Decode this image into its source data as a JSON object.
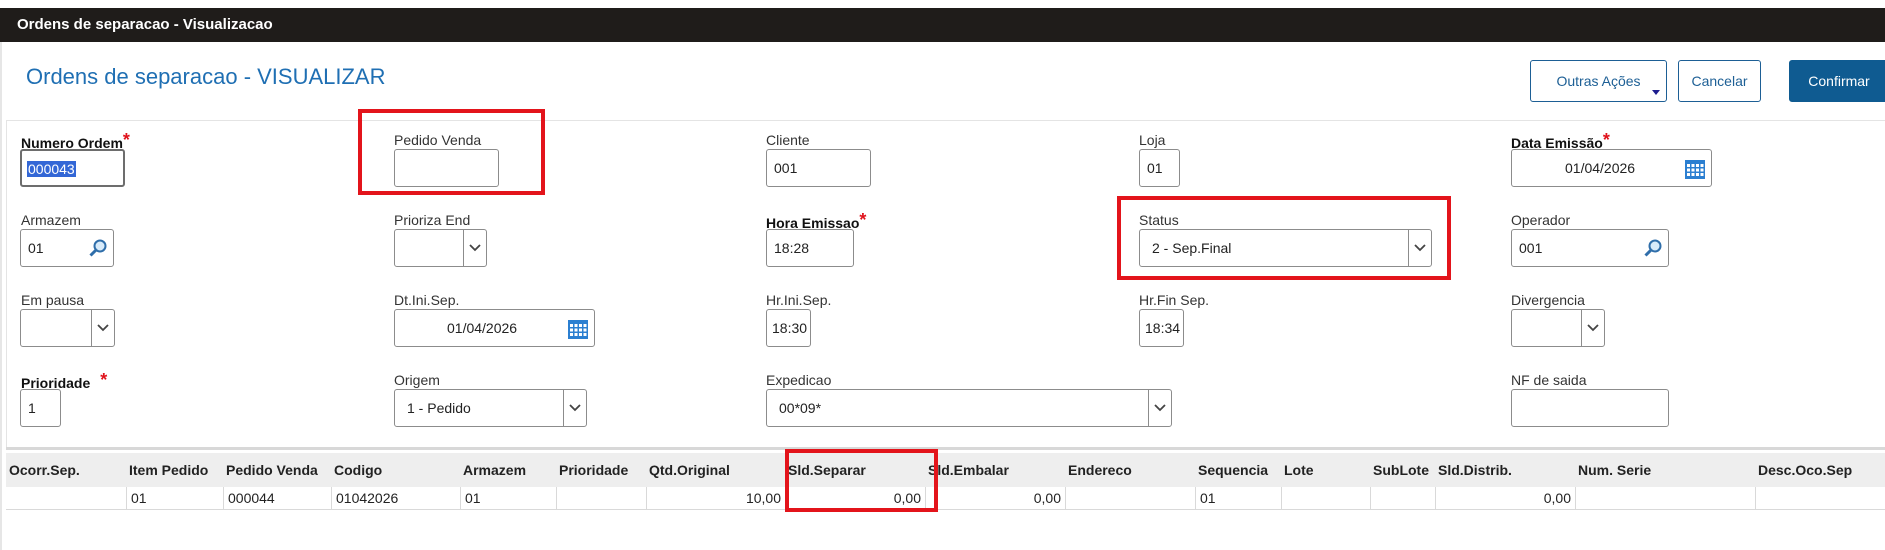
{
  "window": {
    "title": "Ordens de separacao - Visualizacao"
  },
  "page": {
    "title": "Ordens de separacao - VISUALIZAR"
  },
  "toolbar": {
    "outras_label": "Outras Ações",
    "cancelar_label": "Cancelar",
    "confirmar_label": "Confirmar"
  },
  "fields": {
    "numero_ordem": {
      "label": "Numero Ordem",
      "value": "000043"
    },
    "pedido_venda": {
      "label": "Pedido Venda",
      "value": ""
    },
    "cliente": {
      "label": "Cliente",
      "value": "001"
    },
    "loja": {
      "label": "Loja",
      "value": "01"
    },
    "data_emissao": {
      "label": "Data Emissão",
      "value": "01/04/2026"
    },
    "armazem": {
      "label": "Armazem",
      "value": "01"
    },
    "prioriza_end": {
      "label": "Prioriza End",
      "value": ""
    },
    "hora_emissao": {
      "label": "Hora Emissao",
      "value": "18:28"
    },
    "status": {
      "label": "Status",
      "value": "2 - Sep.Final"
    },
    "operador": {
      "label": "Operador",
      "value": "001"
    },
    "em_pausa": {
      "label": "Em pausa",
      "value": ""
    },
    "dt_ini_sep": {
      "label": "Dt.Ini.Sep.",
      "value": "01/04/2026"
    },
    "hr_ini_sep": {
      "label": "Hr.Ini.Sep.",
      "value": "18:30"
    },
    "hr_fin_sep": {
      "label": "Hr.Fin Sep.",
      "value": "18:34"
    },
    "divergencia": {
      "label": "Divergencia",
      "value": ""
    },
    "prioridade": {
      "label": "Prioridade",
      "value": "1"
    },
    "origem": {
      "label": "Origem",
      "value": "1 - Pedido"
    },
    "expedicao": {
      "label": "Expedicao",
      "value": "00*09*"
    },
    "nf_saida": {
      "label": "NF de saida",
      "value": ""
    }
  },
  "grid": {
    "headers": [
      "Ocorr.Sep.",
      "Item Pedido",
      "Pedido Venda",
      "Codigo",
      "Armazem",
      "Prioridade",
      "Qtd.Original",
      "Sld.Separar",
      "Sld.Embalar",
      "Endereco",
      "Sequencia",
      "Lote",
      "SubLote",
      "Sld.Distrib.",
      "Num. Serie",
      "Desc.Oco.Sep"
    ],
    "rows": [
      [
        "",
        "01",
        "000044",
        "01042026",
        "01",
        "",
        "10,00",
        "0,00",
        "0,00",
        "",
        "01",
        "",
        "",
        "0,00",
        "",
        ""
      ]
    ]
  },
  "colors": {
    "accent": "#1f6fb3",
    "primary_button": "#0f5b91",
    "highlight_box": "#e3141b",
    "required_mark": "#e0121b",
    "title_bar": "#1f1c1a"
  }
}
